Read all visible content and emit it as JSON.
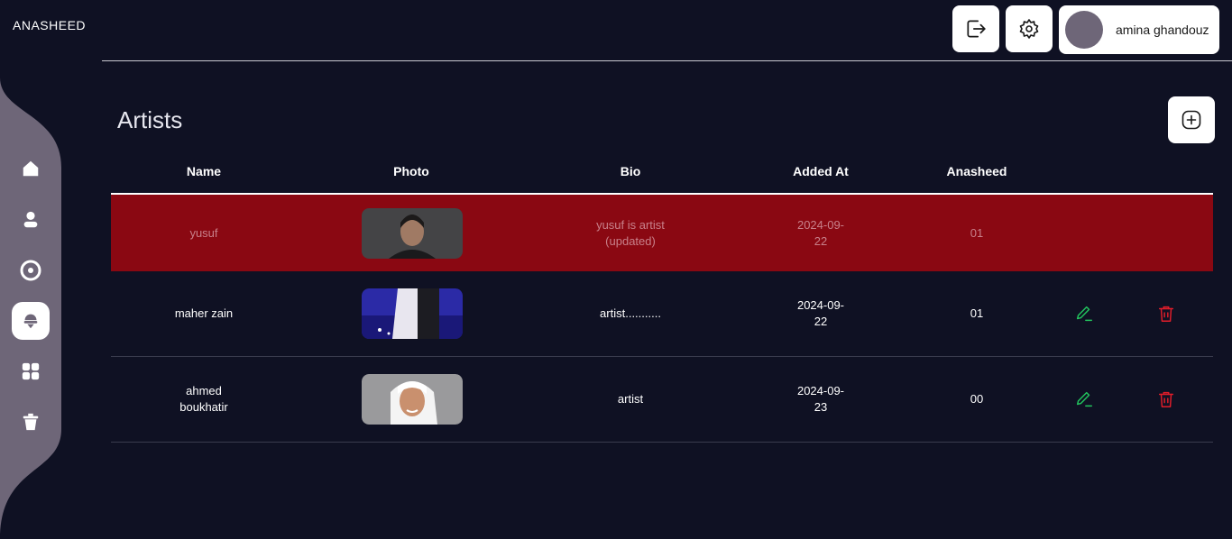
{
  "app": {
    "brand": "ANASHEED"
  },
  "header": {
    "user_name": "amina ghandouz"
  },
  "page": {
    "title": "Artists"
  },
  "table": {
    "columns": [
      "Name",
      "Photo",
      "Bio",
      "Added At",
      "Anasheed"
    ],
    "rows": [
      {
        "name": "yusuf",
        "bio": "yusuf is artist (updated)",
        "added_at": "2024-09-22",
        "anasheed": "01"
      },
      {
        "name": "maher zain",
        "bio": "artist...........",
        "added_at": "2024-09-22",
        "anasheed": "01"
      },
      {
        "name": "ahmed boukhatir",
        "bio": "artist",
        "added_at": "2024-09-23",
        "anasheed": "00"
      }
    ]
  },
  "colors": {
    "background": "#0f1123",
    "sidebar": "#6e6678",
    "highlight_row": "#8a0812",
    "edit": "#22c55e",
    "delete": "#e11d2a"
  }
}
